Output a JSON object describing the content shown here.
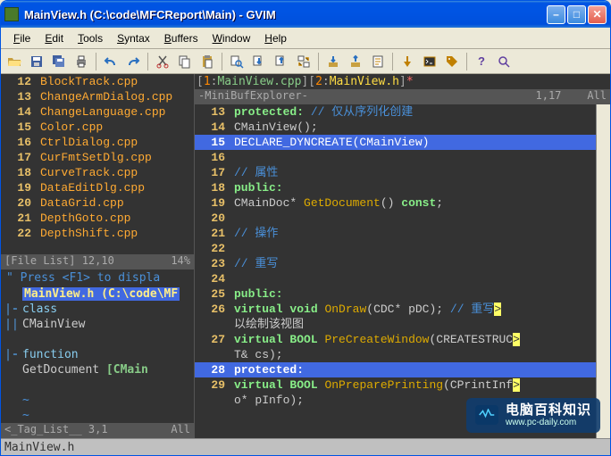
{
  "window": {
    "title": "MainView.h (C:\\code\\MFCReport\\Main) - GVIM"
  },
  "menu": {
    "file": "File",
    "edit": "Edit",
    "tools": "Tools",
    "syntax": "Syntax",
    "buffers": "Buffers",
    "window": "Window",
    "help": "Help"
  },
  "file_list": {
    "items": [
      {
        "n": "12",
        "name": "BlockTrack.cpp"
      },
      {
        "n": "13",
        "name": "ChangeArmDialog.cpp"
      },
      {
        "n": "14",
        "name": "ChangeLanguage.cpp"
      },
      {
        "n": "15",
        "name": "Color.cpp"
      },
      {
        "n": "16",
        "name": "CtrlDialog.cpp"
      },
      {
        "n": "17",
        "name": "CurFmtSetDlg.cpp"
      },
      {
        "n": "18",
        "name": "CurveTrack.cpp"
      },
      {
        "n": "19",
        "name": "DataEditDlg.cpp"
      },
      {
        "n": "20",
        "name": "DataGrid.cpp"
      },
      {
        "n": "21",
        "name": "DepthGoto.cpp"
      },
      {
        "n": "22",
        "name": "DepthShift.cpp"
      }
    ],
    "status_left": "[File List]  12,10",
    "status_right": "14%"
  },
  "hint": "\" Press <F1> to displa",
  "outline": {
    "path": "MainView.h (C:\\code\\MF",
    "class_kw": "class",
    "class_name": "CMainView",
    "func_kw": "function",
    "func_name": "GetDocument",
    "func_sig": "[CMain",
    "status_left": "<_Tag_List__  3,1",
    "status_right": "All"
  },
  "tabs": {
    "t1_num": "1",
    "t1_name": "MainView.cpp",
    "t2_num": "2",
    "t2_name": "MainView.h",
    "t2_mod": "*"
  },
  "mbe": {
    "left": "-MiniBufExplorer-",
    "pos": "1,17",
    "right": "All"
  },
  "code": {
    "lines": [
      {
        "n": "13",
        "hl": false,
        "html": "<span class='kw'>protected:</span> <span class='cm'>// 仅从序列化创建</span>"
      },
      {
        "n": "14",
        "hl": false,
        "html": "        <span class='pl'>CMainView();</span>"
      },
      {
        "n": "15",
        "hl": true,
        "html": "        <span class='fn2'>DECLARE_DYNCREATE</span><span class='pl'>(CMainView)</span>"
      },
      {
        "n": "16",
        "hl": false,
        "html": ""
      },
      {
        "n": "17",
        "hl": false,
        "html": "<span class='cm'>// 属性</span>"
      },
      {
        "n": "18",
        "hl": false,
        "html": "<span class='kw'>public:</span>"
      },
      {
        "n": "19",
        "hl": false,
        "html": "        <span class='pl'>CMainDoc* </span><span class='fn2'>GetDocument</span><span class='pl'>()</span> <span class='kw'>const</span><span class='pl'>;</span>"
      },
      {
        "n": "20",
        "hl": false,
        "html": ""
      },
      {
        "n": "21",
        "hl": false,
        "html": "<span class='cm'>// 操作</span>"
      },
      {
        "n": "22",
        "hl": false,
        "html": ""
      },
      {
        "n": "23",
        "hl": false,
        "html": "<span class='cm'>// 重写</span>"
      },
      {
        "n": "24",
        "hl": false,
        "html": ""
      },
      {
        "n": "25",
        "hl": false,
        "html": "<span class='kw'>public:</span>"
      },
      {
        "n": "26",
        "hl": false,
        "html": "        <span class='kw'>virtual</span> <span class='kw'>void</span> <span class='fn2'>OnDraw</span><span class='pl'>(CDC* pDC);</span>  <span class='cm'>// 重写</span><span style='background:#ff6;color:#333'>&gt;</span>"
      },
      {
        "n": "",
        "hl": false,
        "html": "<span class='pl'>以绘制该视图</span>"
      },
      {
        "n": "27",
        "hl": false,
        "html": "        <span class='kw'>virtual</span> <span class='kw'>BOOL</span> <span class='fn2'>PreCreateWindow</span><span class='pl'>(CREATESTRUC</span><span style='background:#ff6;color:#333'>&gt;</span>"
      },
      {
        "n": "",
        "hl": false,
        "html": "<span class='pl'>T&amp; cs);</span>"
      },
      {
        "n": "28",
        "hl": true,
        "html": "<span class='kw'>protected:</span>"
      },
      {
        "n": "29",
        "hl": false,
        "html": "        <span class='kw'>virtual</span> <span class='kw'>BOOL</span> <span class='fn2'>OnPreparePrinting</span><span class='pl'>(CPrintInf</span><span style='background:#ff6;color:#333'>&gt;</span>"
      },
      {
        "n": "",
        "hl": false,
        "html": "<span class='pl'>o* pInfo);</span>"
      }
    ]
  },
  "bottom_status": "MainView.h",
  "watermark": {
    "cn": "电脑百科知识",
    "url": "www.pc-daily.com"
  }
}
